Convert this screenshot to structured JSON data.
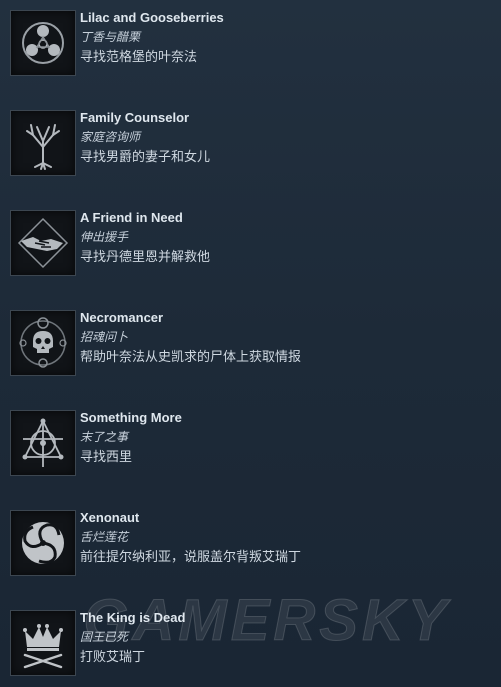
{
  "achievements": [
    {
      "title": "Lilac and Gooseberries",
      "subtitle": "丁香与醋栗",
      "description": "寻找范格堡的叶奈法",
      "icon": "triskelion-icon"
    },
    {
      "title": "Family Counselor",
      "subtitle": "家庭咨询师",
      "description": "寻找男爵的妻子和女儿",
      "icon": "tree-icon"
    },
    {
      "title": "A Friend in Need",
      "subtitle": "伸出援手",
      "description": "寻找丹德里恩并解救他",
      "icon": "handshake-icon"
    },
    {
      "title": "Necromancer",
      "subtitle": "招魂问卜",
      "description": "帮助叶奈法从史凯求的尸体上获取情报",
      "icon": "skull-icon"
    },
    {
      "title": "Something More",
      "subtitle": "末了之事",
      "description": "寻找西里",
      "icon": "arcane-symbol-icon"
    },
    {
      "title": "Xenonaut",
      "subtitle": "舌烂莲花",
      "description": "前往提尔纳利亚，说服盖尔背叛艾瑞丁",
      "icon": "spiral-icon"
    },
    {
      "title": "The King is Dead",
      "subtitle": "国王已死",
      "description": "打败艾瑞丁",
      "icon": "crown-swords-icon"
    }
  ],
  "watermark": "GAMERSKY"
}
